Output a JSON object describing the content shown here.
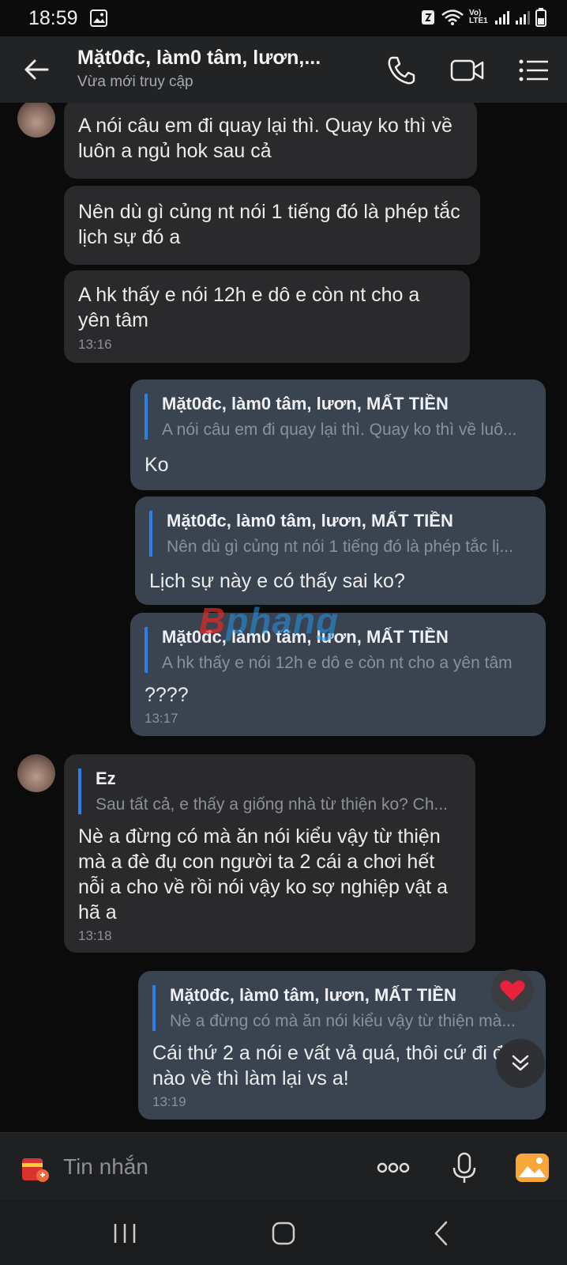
{
  "status_bar": {
    "time": "18:59",
    "network_label": "Vo) LTE1"
  },
  "header": {
    "title": "Mặt0đc, làm0 tâm, lươn,...",
    "subtitle": "Vừa mới truy cập"
  },
  "messages": [
    {
      "dir": "in",
      "text": "A nói câu em đi quay lại thì. Quay ko thì về luôn a ngủ hok sau cả"
    },
    {
      "dir": "in",
      "text": "Nên dù gì củng nt nói 1 tiếng đó là phép tắc lịch sự đó a"
    },
    {
      "dir": "in",
      "text": "A hk thấy e nói 12h e dô e còn nt cho a yên tâm",
      "time": "13:16"
    },
    {
      "dir": "out",
      "reply_name": "Mặt0đc, làm0 tâm, lươn, MẤT TIỀN",
      "reply_text": "A nói câu em đi quay lại thì. Quay ko thì về luô...",
      "text": "Ko"
    },
    {
      "dir": "out",
      "reply_name": "Mặt0đc, làm0 tâm, lươn, MẤT TIỀN",
      "reply_text": "Nên dù gì củng nt nói 1 tiếng đó là phép tắc lị...",
      "text": "Lịch sự này e có thấy sai ko?"
    },
    {
      "dir": "out",
      "reply_name": "Mặt0đc, làm0 tâm, lươn, MẤT TIỀN",
      "reply_text": "A hk thấy e nói 12h e dô e còn nt cho a yên tâm",
      "text": "????",
      "time": "13:17"
    },
    {
      "dir": "in",
      "reply_name": "Ez",
      "reply_text": "Sau tất cả, e thấy a giống nhà từ thiện ko? Ch...",
      "text": "Nè a đừng có mà ăn nói kiểu vậy từ thiện mà a đè đụ con người ta 2 cái a chơi hết nỗi a cho về rồi nói vậy ko sợ nghiệp vật a hã a",
      "time": "13:18"
    },
    {
      "dir": "out",
      "reply_name": "Mặt0đc, làm0 tâm, lươn, MẤT TIỀN",
      "reply_text": "Nè a đừng có mà ăn nói kiểu vậy từ thiện mà...",
      "text": "Cái thứ 2 a nói e vất vả quá, thôi cứ đi đi, nào về thì làm lại vs a!",
      "time": "13:19"
    }
  ],
  "watermark": {
    "first": "B",
    "rest": "phang"
  },
  "input": {
    "placeholder": "Tin nhắn"
  },
  "colors": {
    "outgoing_bubble": "#3a4350",
    "incoming_bubble": "#2a2a2c",
    "reply_bar": "#2d7ee6",
    "header": "#222325"
  }
}
